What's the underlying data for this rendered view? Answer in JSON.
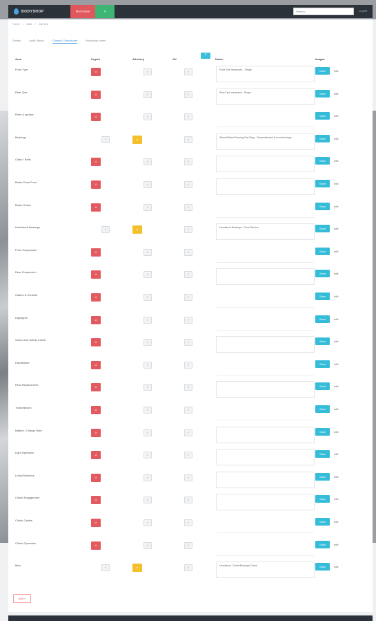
{
  "nav": {
    "brand": "BODYSHOP",
    "red_label": "Not Active",
    "green_label": "+",
    "search_placeholder": "Search...",
    "user_label": "Logout"
  },
  "breadcrumb": [
    "Home",
    "Jobs",
    "Job 116"
  ],
  "tabs": [
    {
      "label": "Details",
      "active": false
    },
    {
      "label": "Audit Status",
      "active": false
    },
    {
      "label": "Chassis Checksheet",
      "active": true
    },
    {
      "label": "Workshop notes",
      "active": false
    }
  ],
  "help_label": "?",
  "columns": {
    "item": "Area",
    "urgent": "Urgent",
    "advisory": "Advisory",
    "ok": "OK",
    "notes": "Notes",
    "images": "Images"
  },
  "status_labels": {
    "urgent": "U",
    "advisory": "A",
    "check": "✓"
  },
  "save_label": "Save",
  "row_link_label": "edit",
  "rows": [
    {
      "label": "Front Tyre",
      "state": "urgent",
      "note": "Front Tyre Measured - Shape",
      "box": true
    },
    {
      "label": "Rear Tyre",
      "state": "urgent",
      "note": "Rear Tyre measured - Shape",
      "box": true
    },
    {
      "label": "Rims & spokes",
      "state": "urgent",
      "note": "",
      "box": false
    },
    {
      "label": "Bearings",
      "state": "advisory",
      "note": "Wheel/Wheel Bearing Test Ring - Cleaned/tested & front bearings",
      "box": true
    },
    {
      "label": "Chain / Belts",
      "state": "urgent",
      "note": "",
      "box": true
    },
    {
      "label": "Brake Pads Front",
      "state": "urgent",
      "note": "",
      "box": true
    },
    {
      "label": "Brake Hoses",
      "state": "urgent",
      "note": "",
      "box": false
    },
    {
      "label": "Headstock Bearings",
      "state": "advisory",
      "note": "Headstock Bearings - Done Service",
      "box": true
    },
    {
      "label": "Front Suspension",
      "state": "urgent",
      "note": "",
      "box": false
    },
    {
      "label": "Rear Suspension",
      "state": "urgent",
      "note": "",
      "box": true
    },
    {
      "label": "Cables & Controls",
      "state": "urgent",
      "note": "",
      "box": false
    },
    {
      "label": "Highlights",
      "state": "urgent",
      "note": "",
      "box": false
    },
    {
      "label": "Sound and Safety Check",
      "state": "urgent",
      "note": "",
      "box": true
    },
    {
      "label": "Handlebars",
      "state": "urgent",
      "note": "",
      "box": false
    },
    {
      "label": "Fluid Replacement",
      "state": "urgent",
      "note": "",
      "box": true
    },
    {
      "label": "Transmission",
      "state": "urgent",
      "note": "",
      "box": false
    },
    {
      "label": "Battery / Charge Rate",
      "state": "urgent",
      "note": "",
      "box": true
    },
    {
      "label": "Light Operation",
      "state": "urgent",
      "note": "",
      "box": true
    },
    {
      "label": "Locks/Switches",
      "state": "urgent",
      "note": "",
      "box": true
    },
    {
      "label": "Clutch Engagement",
      "state": "urgent",
      "note": "",
      "box": true
    },
    {
      "label": "Clutch Cables",
      "state": "urgent",
      "note": "",
      "box": false
    },
    {
      "label": "Clutch Operation",
      "state": "urgent",
      "note": "",
      "box": false
    },
    {
      "label": "Misc",
      "state": "advisory",
      "note": "Headstock / Tyres/Bearings Check",
      "box": true
    }
  ],
  "add_label": "Add +"
}
